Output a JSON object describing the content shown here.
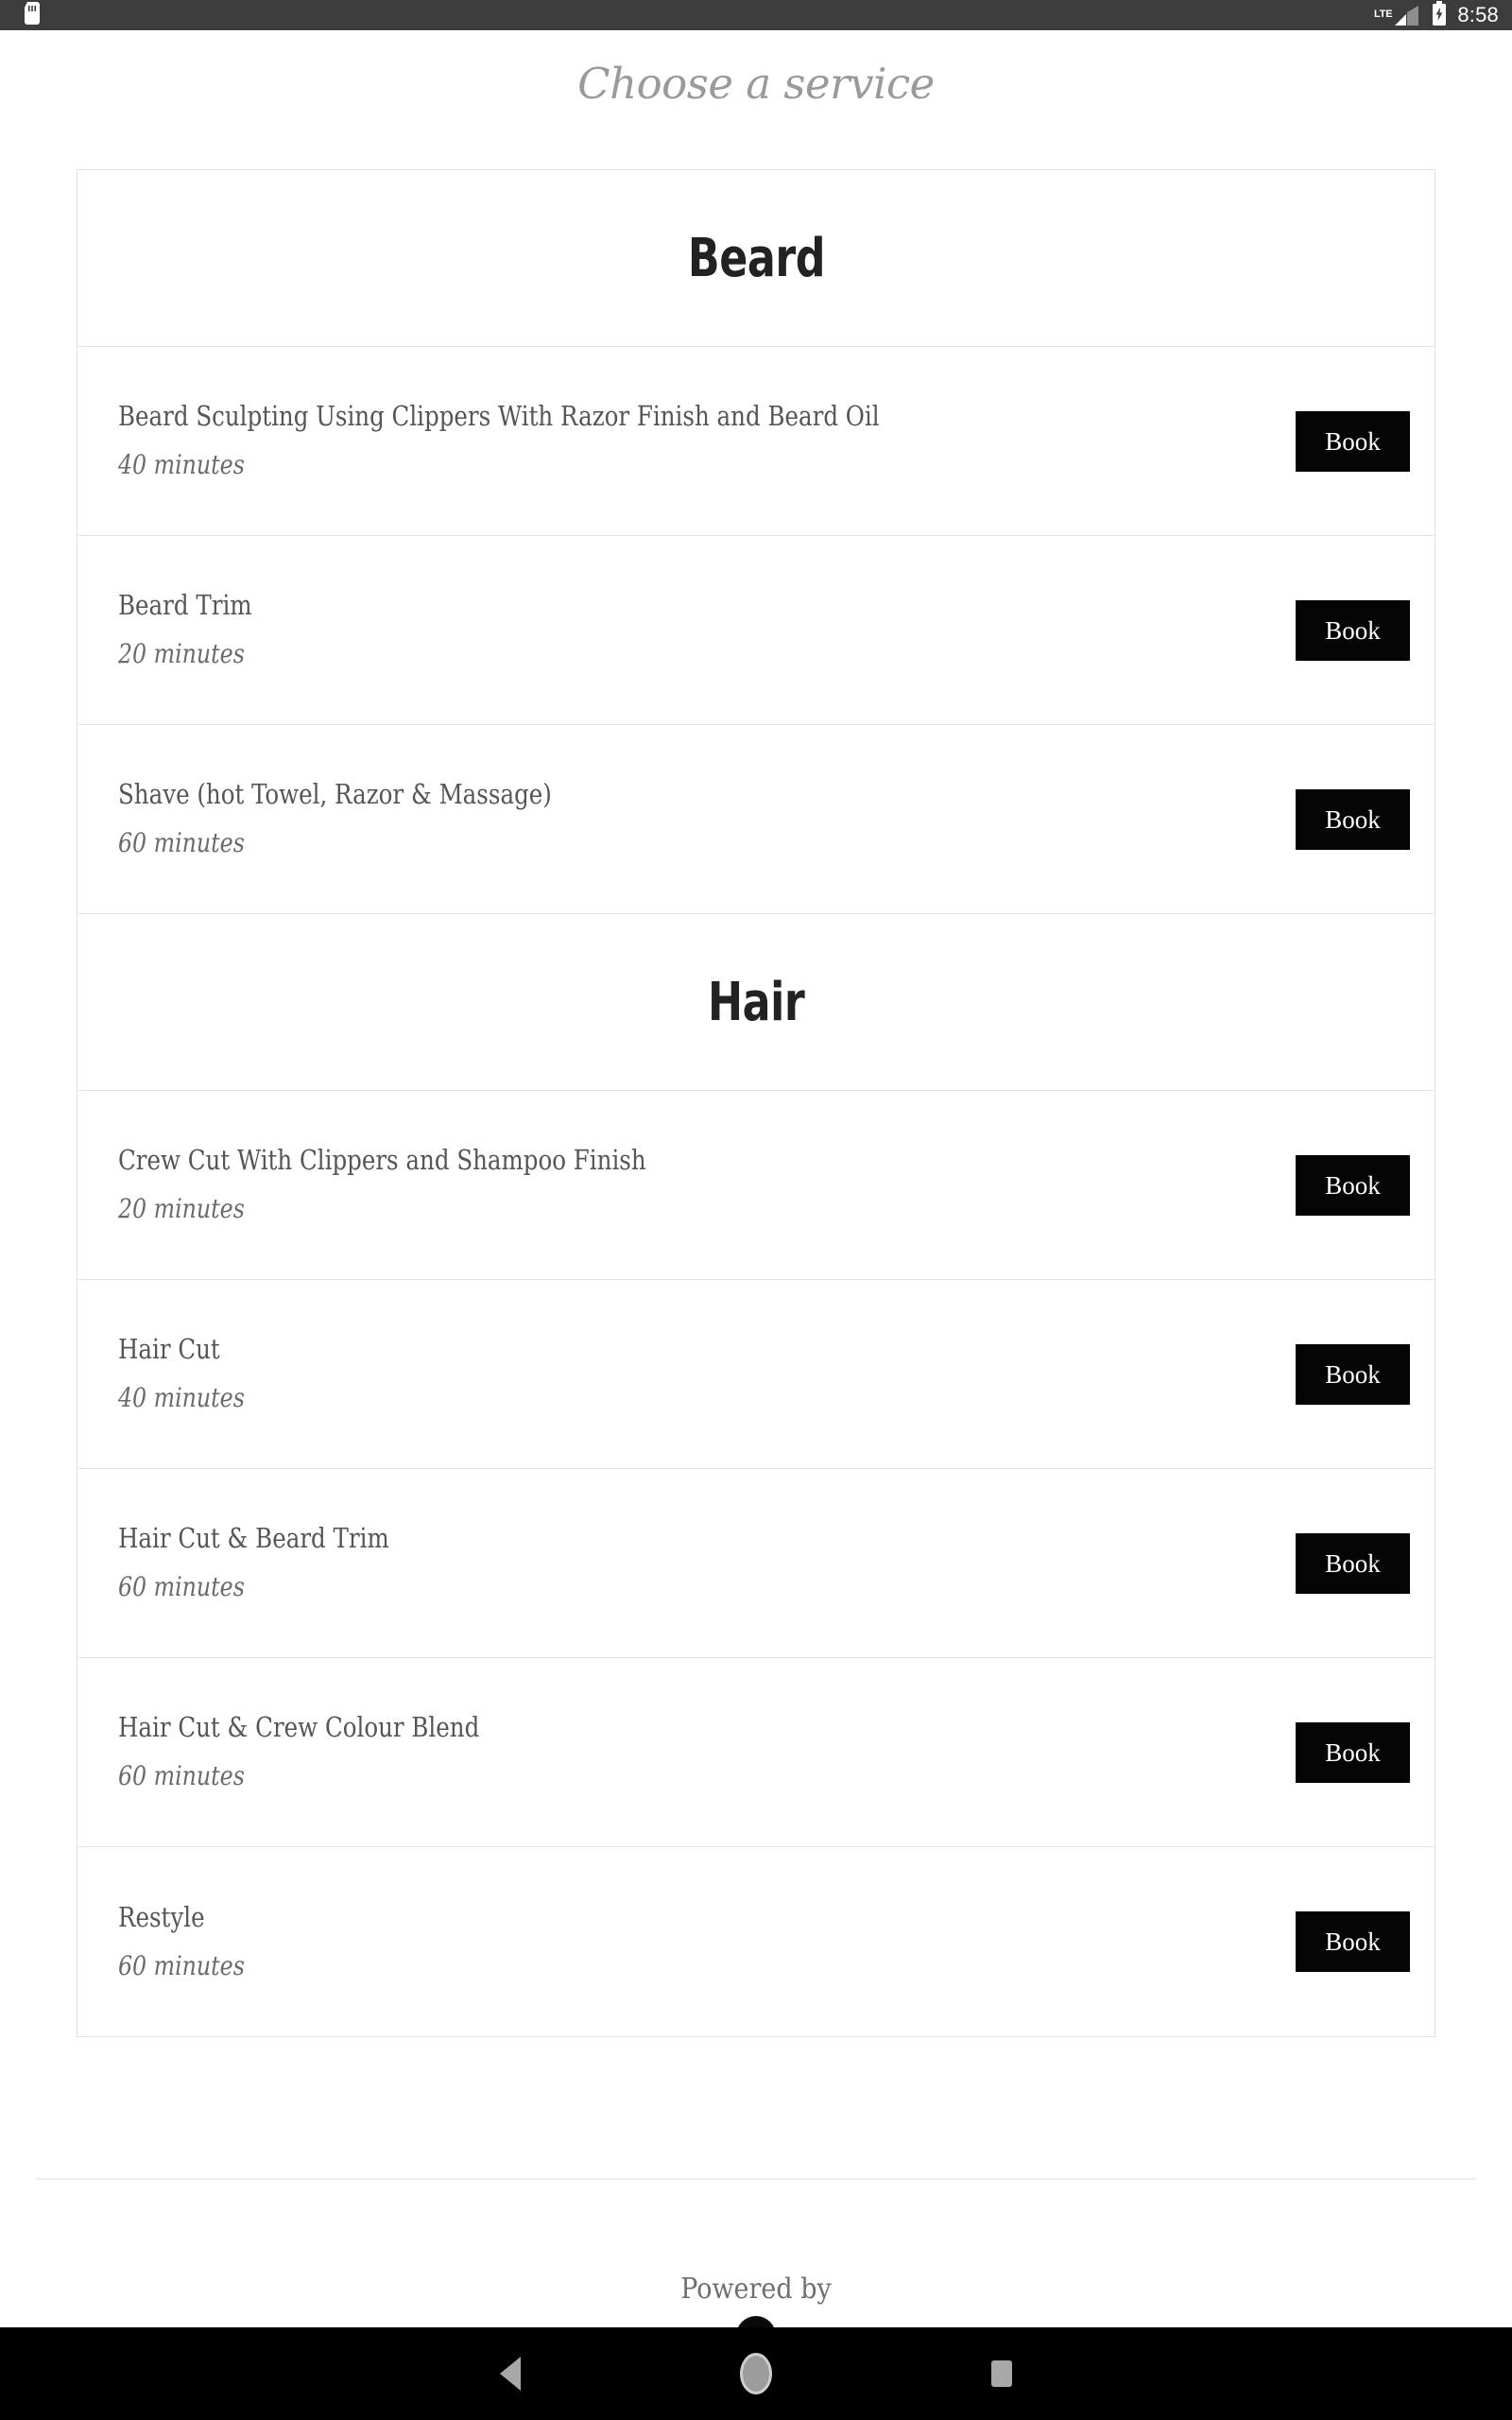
{
  "statusbar": {
    "sdcard_icon": "sdcard-icon",
    "network_label": "LTE",
    "signal_icon": "signal-bars-icon",
    "battery_icon": "battery-charging-icon",
    "time": "8:58"
  },
  "header": {
    "title": "Choose a service"
  },
  "sections": [
    {
      "name": "Beard",
      "services": [
        {
          "name": "Beard Sculpting Using Clippers With Razor Finish and Beard Oil",
          "duration": "40 minutes",
          "book_label": "Book"
        },
        {
          "name": "Beard Trim",
          "duration": "20 minutes",
          "book_label": "Book"
        },
        {
          "name": "Shave (hot Towel, Razor & Massage)",
          "duration": "60 minutes",
          "book_label": "Book"
        }
      ]
    },
    {
      "name": "Hair",
      "services": [
        {
          "name": "Crew Cut With Clippers and Shampoo Finish",
          "duration": "20 minutes",
          "book_label": "Book"
        },
        {
          "name": "Hair Cut",
          "duration": "40 minutes",
          "book_label": "Book"
        },
        {
          "name": "Hair Cut & Beard Trim",
          "duration": "60 minutes",
          "book_label": "Book"
        },
        {
          "name": "Hair Cut & Crew Colour Blend",
          "duration": "60 minutes",
          "book_label": "Book"
        },
        {
          "name": "Restyle",
          "duration": "60 minutes",
          "book_label": "Book"
        }
      ]
    }
  ],
  "footer": {
    "powered_by": "Powered by",
    "logo_icon": "brand-logo-icon"
  },
  "navbar": {
    "back_icon": "back-triangle-icon",
    "home_icon": "home-circle-icon",
    "recents_icon": "recents-square-icon"
  },
  "colors": {
    "statusbar_bg": "#3c3c3c",
    "button_bg": "#050505",
    "border": "#e2e2e2",
    "title_text": "#9a9a9a",
    "service_text": "#555555",
    "navbar_bg": "#000000"
  }
}
